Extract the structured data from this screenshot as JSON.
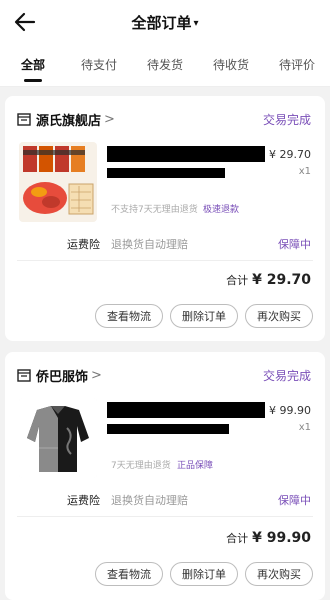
{
  "header": {
    "title": "全部订单",
    "caret": "▾"
  },
  "tabs": [
    "全部",
    "待支付",
    "待发货",
    "待收货",
    "待评价"
  ],
  "orders": [
    {
      "store": "源氏旗舰店",
      "status": "交易完成",
      "price": "¥ 29.70",
      "qty": "x1",
      "tag_gray": "不支持7天无理由退货",
      "tag_purple": "极速退款",
      "insurance_label": "运费险",
      "insurance_text": "退换货自动理赔",
      "insurance_status": "保障中",
      "total_label": "合计",
      "total": "¥ 29.70",
      "buttons": [
        "查看物流",
        "删除订单",
        "再次购买"
      ]
    },
    {
      "store": "侨巴服饰",
      "status": "交易完成",
      "price": "¥ 99.90",
      "qty": "x1",
      "tag_gray": "7天无理由退货",
      "tag_purple": "正品保障",
      "insurance_label": "运费险",
      "insurance_text": "退换货自动理赔",
      "insurance_status": "保障中",
      "total_label": "合计",
      "total": "¥ 99.90",
      "buttons": [
        "查看物流",
        "删除订单",
        "再次购买"
      ]
    }
  ],
  "icons": {
    "back": "back-arrow-icon",
    "store": "store-icon",
    "chevron": "chevron-right-icon"
  },
  "colors": {
    "accent": "#7a4fb8"
  }
}
